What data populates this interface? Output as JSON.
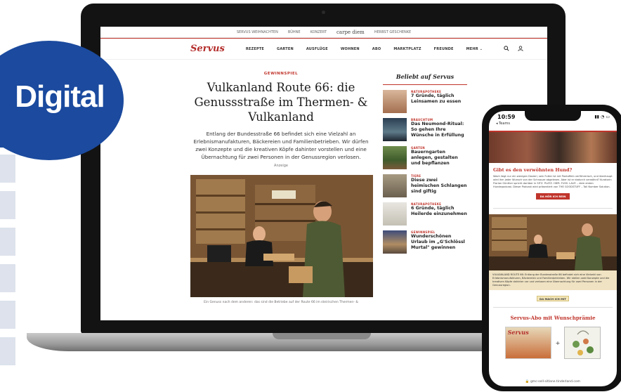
{
  "badge": {
    "label": "Digital"
  },
  "laptop": {
    "top_strip": {
      "items": [
        "SERVUS WEIHNACHTEN",
        "BÜHNE",
        "KONZERT",
        "carpe diem",
        "HERBST GESCHENKE"
      ]
    },
    "logo": "Servus",
    "nav": [
      "REZEPTE",
      "GARTEN",
      "AUSFLÜGE",
      "WOHNEN",
      "ABO",
      "MARKTPLATZ",
      "FREUNDE",
      "MEHR ⌄"
    ],
    "article": {
      "kicker": "GEWINNSPIEL",
      "headline": "Vulkanland Route 66: die Genussstraße im Thermen- & Vulkanland",
      "lead": "Entlang der Bundesstraße 66 befindet sich eine Vielzahl an Erlebnismanufakturen, Bäckereien und Familienbetrieben. Wir dürfen zwei Konzepte und die kreativen Köpfe dahinter vorstellen und eine Übernachtung für zwei Personen in der Genussregion verlosen.",
      "anzeige": "Anzeige",
      "photo_credit": "Foto: Steirisches Vulkanland",
      "caption": "Ein Genuss nach dem anderen: das sind die Betriebe auf der Route 66 im steirischen Thermen- &"
    },
    "sidebar": {
      "title": "Beliebt auf Servus",
      "items": [
        {
          "category": "NATURAPOTHEKE",
          "title": "7 Gründe, täglich Leinsamen zu essen"
        },
        {
          "category": "BRAUCHTUM",
          "title": "Das Neumond-Ritual: So gehen Ihre Wünsche in Erfüllung"
        },
        {
          "category": "GARTEN",
          "title": "Bauerngarten anlegen, gestalten und bepflanzen"
        },
        {
          "category": "TIERE",
          "title": "Diese zwei heimischen Schlangen sind giftig"
        },
        {
          "category": "NATURAPOTHEKE",
          "title": "6 Gründe, täglich Heilerde einzunehmen"
        },
        {
          "category": "GEWINNSPIEL",
          "title": "Wunderschönen Urlaub im „G'Schlössl Murtal\" gewinnen"
        }
      ]
    }
  },
  "phone": {
    "time": "10:59",
    "back": "◂ Teams",
    "signal": "▮▮ ◔ ▭",
    "promo": {
      "title": "Gibt es den verwöhnten Hund?",
      "text": "Wach liegt nur ein wenigen Dosierl, sein Futter ist mit Pantoffeln verführerisch, und überhaupt wird ihm jeder Wunsch von der Schnauze abgelesen. Aber ist er dadurch verwöhnt? Kuratorin Florian Günther spricht darüber in SITZ. PLATZ. HIER. FUSS. LAUF. – dem ersten Hundepodcast. Dieser Podcast wird präsentiert von THE GOODSTUFF – Tail Number Solution.",
      "button": "DA HÖR ICH REIN"
    },
    "banner_text": "VULKANLAND ROUTE 66: Entlang der Bundesstraße 66 befindet sich eine Vielzahl von Erlebnismanufakturen, Bäckereien und Familienbetrieben. Wir stellen zwei Konzepte und die kreativen Köpfe dahinter vor und verlosen eine Übernachtung für zwei Personen in der Genussregion.",
    "button2": "DA MACH ICH MIT",
    "abo_title": "Servus-Abo mit Wunschprämie",
    "magazine_logo": "Servus",
    "url": "🔒 gmc-sell-sitlane.tinderland.com"
  }
}
